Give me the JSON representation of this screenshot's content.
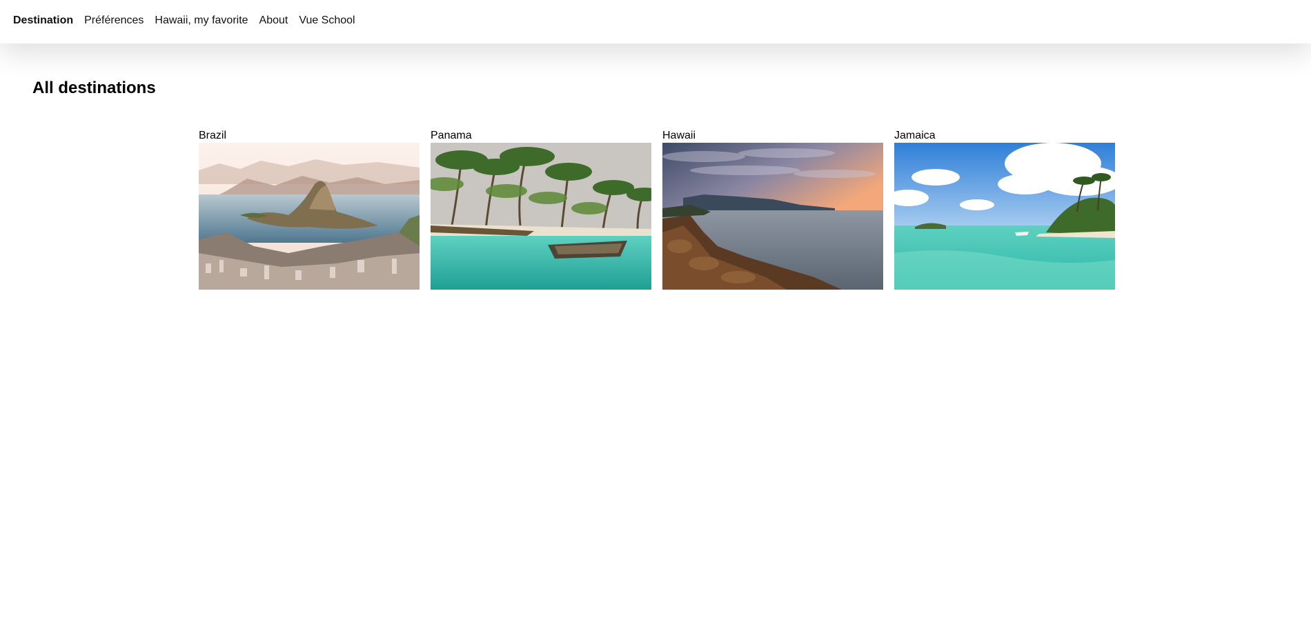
{
  "nav": {
    "items": [
      {
        "label": "Destination"
      },
      {
        "label": "Préférences"
      },
      {
        "label": "Hawaii, my favorite"
      },
      {
        "label": "About"
      },
      {
        "label": "Vue School"
      }
    ]
  },
  "main": {
    "title": "All destinations",
    "destinations": [
      {
        "name": "Brazil"
      },
      {
        "name": "Panama"
      },
      {
        "name": "Hawaii"
      },
      {
        "name": "Jamaica"
      }
    ]
  }
}
